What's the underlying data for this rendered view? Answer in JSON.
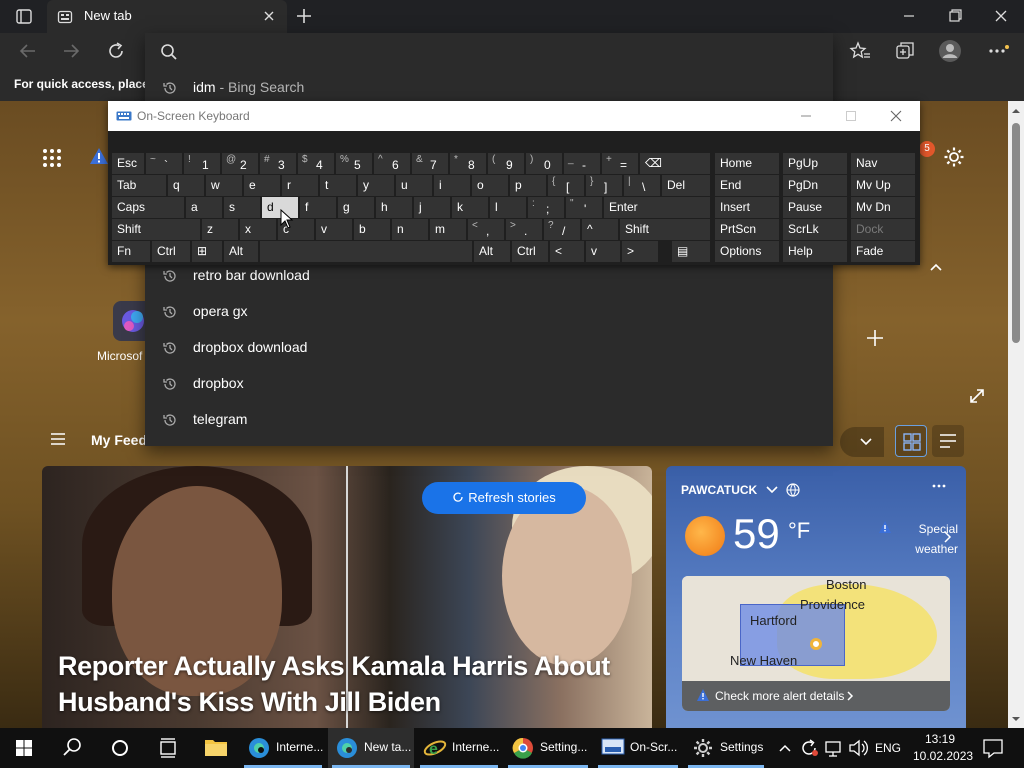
{
  "browser": {
    "active_tab_title": "New tab",
    "omnibox_value": "",
    "favorites_hint": "For quick access, place y"
  },
  "omnibox": {
    "suggestions": [
      {
        "text": "idm",
        "sub": " - Bing Search"
      },
      {
        "text": "retro bar download",
        "sub": ""
      },
      {
        "text": "opera gx",
        "sub": ""
      },
      {
        "text": "dropbox download",
        "sub": ""
      },
      {
        "text": "dropbox",
        "sub": ""
      },
      {
        "text": "telegram",
        "sub": ""
      }
    ]
  },
  "osk": {
    "title": "On-Screen Keyboard",
    "rows": {
      "r1": [
        {
          "label": "Esc"
        },
        {
          "alt": "~",
          "main": "`"
        },
        {
          "alt": "!",
          "main": "1"
        },
        {
          "alt": "@",
          "main": "2"
        },
        {
          "alt": "#",
          "main": "3"
        },
        {
          "alt": "$",
          "main": "4"
        },
        {
          "alt": "%",
          "main": "5"
        },
        {
          "alt": "^",
          "main": "6"
        },
        {
          "alt": "&",
          "main": "7"
        },
        {
          "alt": "*",
          "main": "8"
        },
        {
          "alt": "(",
          "main": "9"
        },
        {
          "alt": ")",
          "main": "0"
        },
        {
          "alt": "_",
          "main": "-"
        },
        {
          "alt": "+",
          "main": "="
        },
        {
          "label": "⌫"
        }
      ],
      "r2": [
        {
          "label": "Tab"
        },
        {
          "label": "q"
        },
        {
          "label": "w"
        },
        {
          "label": "e"
        },
        {
          "label": "r"
        },
        {
          "label": "t"
        },
        {
          "label": "y"
        },
        {
          "label": "u"
        },
        {
          "label": "i"
        },
        {
          "label": "o"
        },
        {
          "label": "p"
        },
        {
          "alt": "{",
          "main": "["
        },
        {
          "alt": "}",
          "main": "]"
        },
        {
          "alt": "|",
          "main": "\\"
        },
        {
          "label": "Del"
        }
      ],
      "r3": [
        {
          "label": "Caps"
        },
        {
          "label": "a"
        },
        {
          "label": "s"
        },
        {
          "label": "d"
        },
        {
          "label": "f"
        },
        {
          "label": "g"
        },
        {
          "label": "h"
        },
        {
          "label": "j"
        },
        {
          "label": "k"
        },
        {
          "label": "l"
        },
        {
          "alt": ":",
          "main": ";"
        },
        {
          "alt": "\"",
          "main": "'"
        },
        {
          "label": "Enter"
        }
      ],
      "r4": [
        {
          "label": "Shift"
        },
        {
          "label": "z"
        },
        {
          "label": "x"
        },
        {
          "label": "c"
        },
        {
          "label": "v"
        },
        {
          "label": "b"
        },
        {
          "label": "n"
        },
        {
          "label": "m"
        },
        {
          "alt": "<",
          "main": ","
        },
        {
          "alt": ">",
          "main": "."
        },
        {
          "alt": "?",
          "main": "/"
        },
        {
          "label": "^"
        },
        {
          "label": "Shift"
        }
      ],
      "r5": [
        {
          "label": "Fn"
        },
        {
          "label": "Ctrl"
        },
        {
          "label": "⊞"
        },
        {
          "label": "Alt"
        },
        {
          "label": ""
        },
        {
          "label": "Alt"
        },
        {
          "label": "Ctrl"
        },
        {
          "label": "<"
        },
        {
          "label": "v"
        },
        {
          "label": ">"
        },
        {
          "label": "▤"
        }
      ],
      "nav_rows": [
        [
          "Home",
          "PgUp",
          "Nav"
        ],
        [
          "End",
          "PgDn",
          "Mv Up"
        ],
        [
          "Insert",
          "Pause",
          "Mv Dn"
        ],
        [
          "PrtScn",
          "ScrLk",
          "Dock"
        ],
        [
          "Options",
          "Help",
          "Fade"
        ]
      ]
    }
  },
  "ntp": {
    "notification_count": "5",
    "site_label": "Microsof",
    "feed_title": "My Feed",
    "hero": {
      "title": "Reporter Actually Asks Kamala Harris About Husband's Kiss With Jill Biden",
      "refresh_label": "Refresh stories"
    },
    "weather": {
      "location": "PAWCATUCK",
      "temperature": "59",
      "unit": "°F",
      "alert": "Special weather",
      "map_labels": [
        "Boston",
        "Providence",
        "Hartford",
        "New Haven"
      ],
      "alert_link": "Check more alert details"
    }
  },
  "taskbar": {
    "apps": [
      {
        "label": "Interne..."
      },
      {
        "label": "New ta..."
      },
      {
        "label": "Interne..."
      },
      {
        "label": "Setting..."
      },
      {
        "label": "On-Scr..."
      },
      {
        "label": "Settings"
      }
    ],
    "language": "ENG",
    "time": "13:19",
    "date": "10.02.2023"
  },
  "colors": {
    "accent": "#1a73e8",
    "chrome_dark": "#202124",
    "taskbar": "#101010"
  }
}
